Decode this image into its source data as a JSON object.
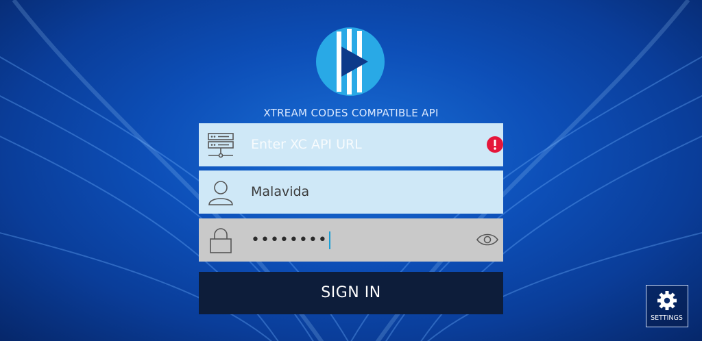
{
  "header": {
    "api_title": "XTREAM CODES COMPATIBLE API"
  },
  "form": {
    "url_placeholder": "Enter XC API URL",
    "url_value": "",
    "username_value": "Malavida",
    "password_value": "••••••••",
    "signin_label": "SIGN IN"
  },
  "icons": {
    "logo": "play-logo-icon",
    "server": "server-icon",
    "user": "user-icon",
    "lock": "lock-icon",
    "alert": "alert-icon",
    "eye": "eye-icon",
    "gear": "gear-icon"
  },
  "settings": {
    "label": "SETTINGS"
  },
  "colors": {
    "background": "#0d4fb8",
    "field_active": "#cfe8f7",
    "field_password": "#c9c9c9",
    "signin_button": "#0d1d3a",
    "alert": "#e5163a",
    "logo_blue": "#29a9e6"
  }
}
